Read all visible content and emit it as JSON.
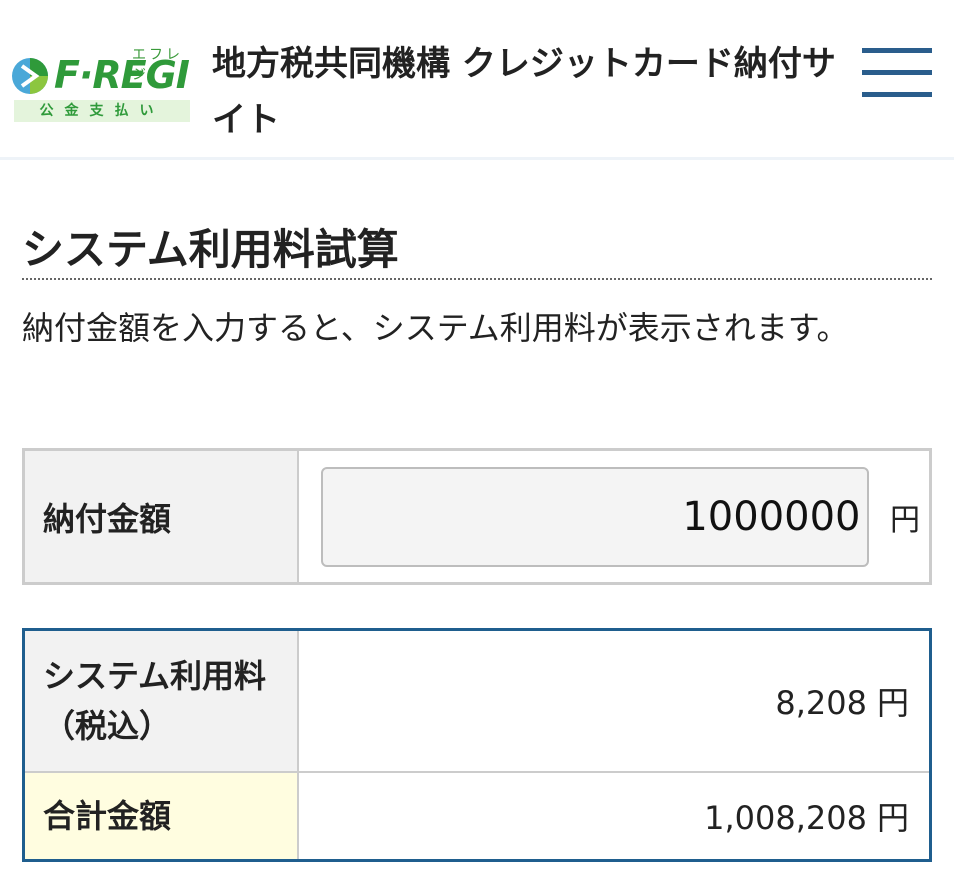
{
  "header": {
    "logo": {
      "kana": "エフレジ",
      "word": "F·REGI",
      "sub": "公金支払い"
    },
    "site_title": "地方税共同機構 クレジットカード納付サイト",
    "menu_icon": "hamburger-menu-icon"
  },
  "main": {
    "section_title": "システム利用料試算",
    "description": "納付金額を入力すると、システム利用料が表示されます。",
    "form": {
      "amount_label": "納付金額",
      "amount_value": "1000000",
      "unit": "円"
    },
    "result": {
      "fee_label": "システム利用料（税込）",
      "fee_value": "8,208",
      "total_label": "合計金額",
      "total_value": "1,008,208",
      "unit": "円"
    }
  },
  "colors": {
    "brand_green": "#2f9a3a",
    "accent_blue": "#1f5e8e",
    "total_highlight": "#fffde0"
  }
}
